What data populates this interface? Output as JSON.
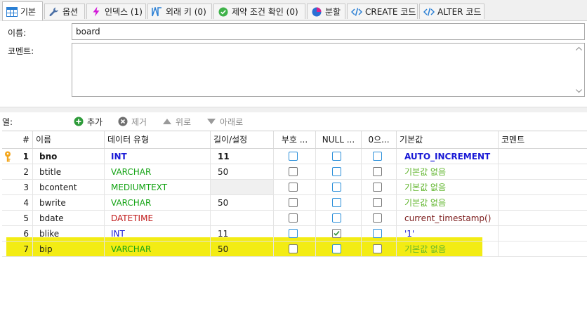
{
  "tabs": [
    {
      "label": "기본",
      "icon": "table-icon",
      "active": true
    },
    {
      "label": "옵션",
      "icon": "wrench-icon"
    },
    {
      "label": "인덱스 (1)",
      "icon": "lightning-icon"
    },
    {
      "label": "외래 키 (0)",
      "icon": "foreign-key-icon"
    },
    {
      "label": "제약 조건 확인 (0)",
      "icon": "check-circle-icon"
    },
    {
      "label": "분할",
      "icon": "pie-icon"
    },
    {
      "label": "CREATE 코드",
      "icon": "code-icon"
    },
    {
      "label": "ALTER 코드",
      "icon": "code-icon"
    }
  ],
  "form": {
    "name_label": "이름:",
    "name_value": "board",
    "comment_label": "코멘트:",
    "comment_value": ""
  },
  "columns_toolbar": {
    "label": "열:",
    "add": "추가",
    "remove": "제거",
    "up": "위로",
    "down": "아래로"
  },
  "grid": {
    "headers": [
      "#",
      "이름",
      "데이터 유형",
      "길이/설정",
      "부호 ...",
      "NULL ...",
      "0으...",
      "기본값",
      "코멘트"
    ],
    "rows": [
      {
        "num": "1",
        "name": "bno",
        "type": "INT",
        "length": "11",
        "unsigned": false,
        "nullable": false,
        "zerofill": false,
        "default": "AUTO_INCREMENT",
        "comment": "",
        "pk": true
      },
      {
        "num": "2",
        "name": "btitle",
        "type": "VARCHAR",
        "length": "50",
        "unsigned": false,
        "nullable": false,
        "zerofill": false,
        "default": "기본값 없음",
        "comment": ""
      },
      {
        "num": "3",
        "name": "bcontent",
        "type": "MEDIUMTEXT",
        "length": "",
        "unsigned": false,
        "nullable": false,
        "zerofill": false,
        "default": "기본값 없음",
        "comment": ""
      },
      {
        "num": "4",
        "name": "bwrite",
        "type": "VARCHAR",
        "length": "50",
        "unsigned": false,
        "nullable": false,
        "zerofill": false,
        "default": "기본값 없음",
        "comment": ""
      },
      {
        "num": "5",
        "name": "bdate",
        "type": "DATETIME",
        "length": "",
        "unsigned": false,
        "nullable": false,
        "zerofill": false,
        "default": "current_timestamp()",
        "comment": ""
      },
      {
        "num": "6",
        "name": "blike",
        "type": "INT",
        "length": "11",
        "unsigned": false,
        "nullable": true,
        "zerofill": false,
        "default": "'1'",
        "comment": ""
      },
      {
        "num": "7",
        "name": "bip",
        "type": "VARCHAR",
        "length": "50",
        "unsigned": false,
        "nullable": false,
        "zerofill": false,
        "default": "기본값 없음",
        "comment": "",
        "highlighted": true
      }
    ]
  },
  "colors": {
    "int": "#1a1ad6",
    "string": "#13a313",
    "datetime": "#c01818",
    "default_none": "#5fb52b",
    "default_expr": "#7a1a1a",
    "auto_increment": "#1a1ad6",
    "highlight": "#f2ea00",
    "checkbox_blue": "#2b8fd9",
    "key_icon": "#f3a61c"
  }
}
